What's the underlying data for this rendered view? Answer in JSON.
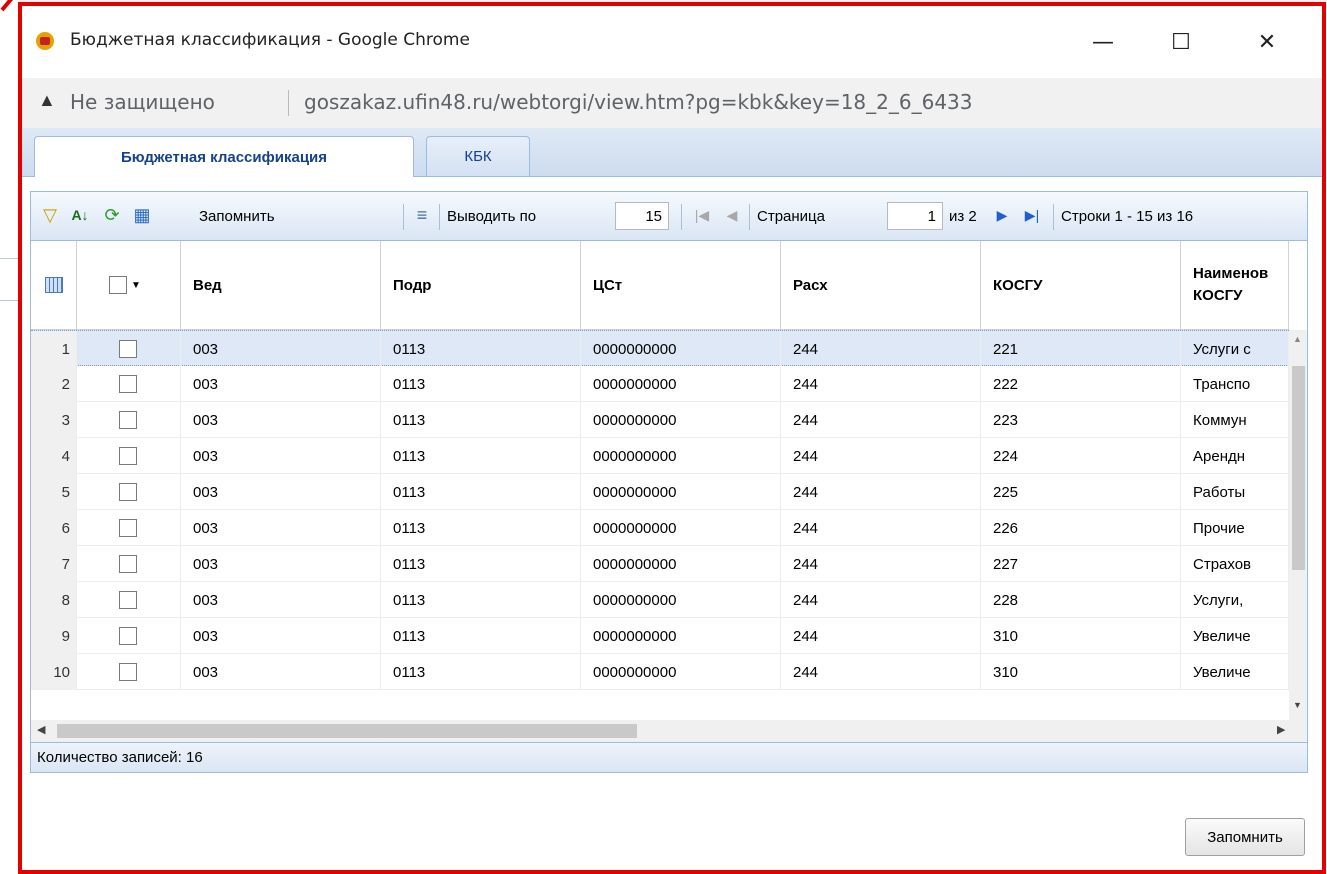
{
  "window": {
    "title": "Бюджетная классификация - Google Chrome",
    "minimize": "—",
    "maximize": "☐",
    "close": "✕"
  },
  "address": {
    "security": "Не защищено",
    "url": "goszakaz.ufin48.ru/webtorgi/view.htm?pg=kbk&key=18_2_6_6433"
  },
  "tabs": [
    {
      "label": "Бюджетная классификация",
      "active": true
    },
    {
      "label": "КБК",
      "active": false
    }
  ],
  "toolbar": {
    "remember_label": "Запомнить",
    "per_page_label": "Выводить по",
    "per_page_value": "15",
    "page_label": "Страница",
    "page_value": "1",
    "of_pages": "из 2",
    "rows_info": "Строки 1 - 15 из 16"
  },
  "grid": {
    "columns": [
      "Вед",
      "Подр",
      "ЦСт",
      "Расх",
      "КОСГУ",
      "Наименов КОСГУ"
    ],
    "rows": [
      {
        "n": "1",
        "ved": "003",
        "podr": "0113",
        "cst": "0000000000",
        "rash": "244",
        "kosgu": "221",
        "name": "Услуги с"
      },
      {
        "n": "2",
        "ved": "003",
        "podr": "0113",
        "cst": "0000000000",
        "rash": "244",
        "kosgu": "222",
        "name": "Транспо"
      },
      {
        "n": "3",
        "ved": "003",
        "podr": "0113",
        "cst": "0000000000",
        "rash": "244",
        "kosgu": "223",
        "name": "Коммун"
      },
      {
        "n": "4",
        "ved": "003",
        "podr": "0113",
        "cst": "0000000000",
        "rash": "244",
        "kosgu": "224",
        "name": "Арендн"
      },
      {
        "n": "5",
        "ved": "003",
        "podr": "0113",
        "cst": "0000000000",
        "rash": "244",
        "kosgu": "225",
        "name": "Работы"
      },
      {
        "n": "6",
        "ved": "003",
        "podr": "0113",
        "cst": "0000000000",
        "rash": "244",
        "kosgu": "226",
        "name": "Прочие"
      },
      {
        "n": "7",
        "ved": "003",
        "podr": "0113",
        "cst": "0000000000",
        "rash": "244",
        "kosgu": "227",
        "name": "Страхов"
      },
      {
        "n": "8",
        "ved": "003",
        "podr": "0113",
        "cst": "0000000000",
        "rash": "244",
        "kosgu": "228",
        "name": "Услуги,"
      },
      {
        "n": "9",
        "ved": "003",
        "podr": "0113",
        "cst": "0000000000",
        "rash": "244",
        "kosgu": "310",
        "name": "Увеличе"
      },
      {
        "n": "10",
        "ved": "003",
        "podr": "0113",
        "cst": "0000000000",
        "rash": "244",
        "kosgu": "310",
        "name": "Увеличе"
      }
    ]
  },
  "footer": {
    "count": "Количество записей: 16"
  },
  "dialog": {
    "save_button": "Запомнить"
  }
}
